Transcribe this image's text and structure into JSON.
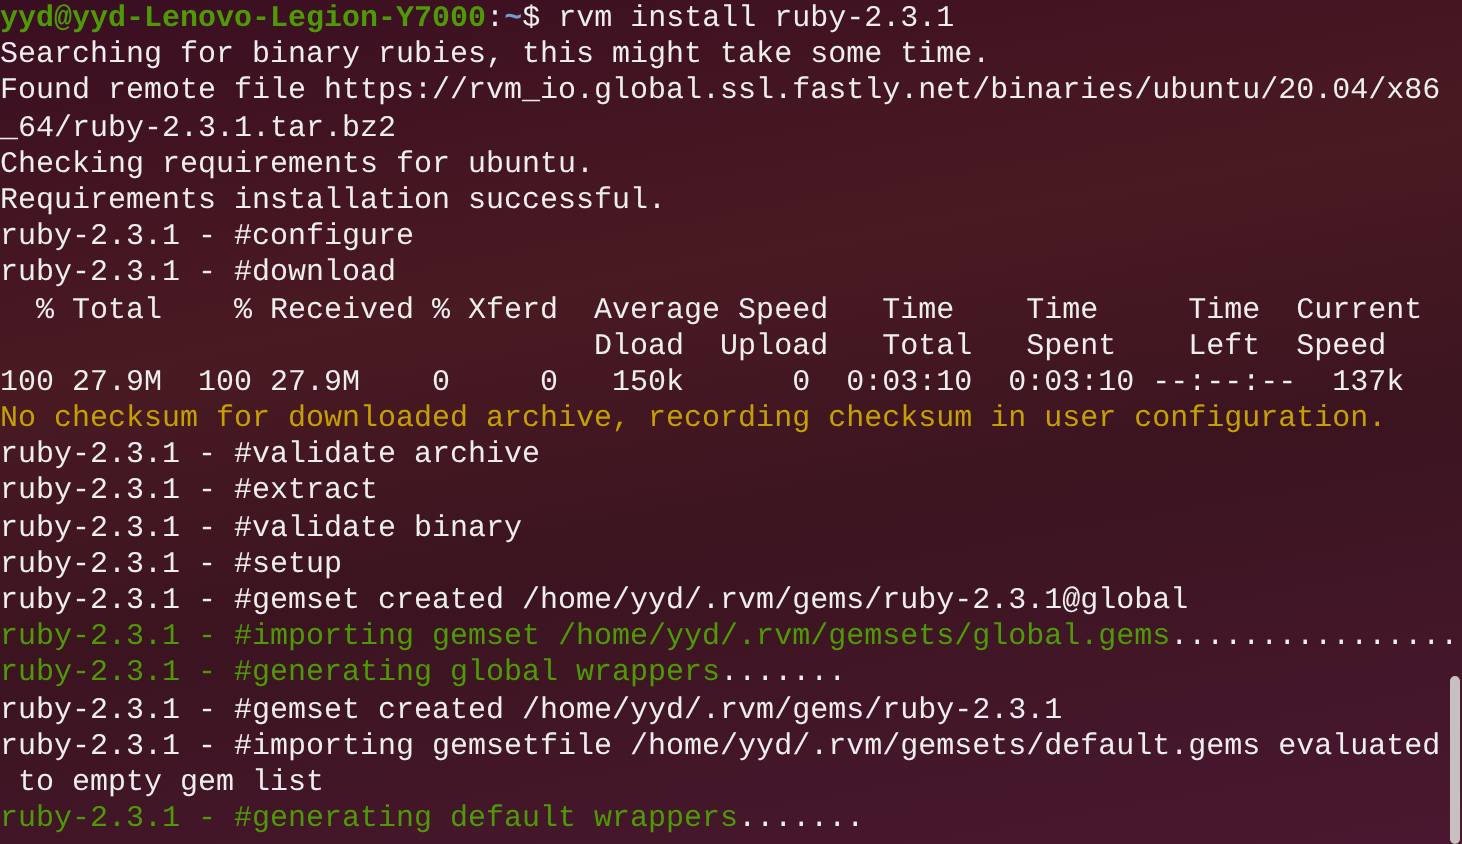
{
  "terminal": {
    "lines": [
      [
        {
          "kind": "user",
          "text": "yyd@yyd-Lenovo-Legion-Y7000"
        },
        {
          "kind": "plain",
          "text": ":"
        },
        {
          "kind": "path",
          "text": "~"
        },
        {
          "kind": "plain",
          "text": "$ rvm install ruby-2.3.1"
        }
      ],
      [
        {
          "kind": "plain",
          "text": "Searching for binary rubies, this might take some time."
        }
      ],
      [
        {
          "kind": "plain",
          "text": "Found remote file https://rvm_io.global.ssl.fastly.net/binaries/ubuntu/20.04/x86"
        }
      ],
      [
        {
          "kind": "plain",
          "text": "_64/ruby-2.3.1.tar.bz2"
        }
      ],
      [
        {
          "kind": "plain",
          "text": "Checking requirements for ubuntu."
        }
      ],
      [
        {
          "kind": "plain",
          "text": "Requirements installation successful."
        }
      ],
      [
        {
          "kind": "plain",
          "text": "ruby-2.3.1 - #configure"
        }
      ],
      [
        {
          "kind": "plain",
          "text": "ruby-2.3.1 - #download"
        }
      ],
      [
        {
          "kind": "plain",
          "text": "  % Total    % Received % Xferd  Average Speed   Time    Time     Time  Current"
        }
      ],
      [
        {
          "kind": "plain",
          "text": "                                 Dload  Upload   Total   Spent    Left  Speed"
        }
      ],
      [
        {
          "kind": "plain",
          "text": "100 27.9M  100 27.9M    0     0   150k      0  0:03:10  0:03:10 --:--:--  137k"
        }
      ],
      [
        {
          "kind": "warning",
          "text": "No checksum for downloaded archive, recording checksum in user configuration."
        }
      ],
      [
        {
          "kind": "plain",
          "text": "ruby-2.3.1 - #validate archive"
        }
      ],
      [
        {
          "kind": "plain",
          "text": "ruby-2.3.1 - #extract"
        }
      ],
      [
        {
          "kind": "plain",
          "text": "ruby-2.3.1 - #validate binary"
        }
      ],
      [
        {
          "kind": "plain",
          "text": "ruby-2.3.1 - #setup"
        }
      ],
      [
        {
          "kind": "plain",
          "text": "ruby-2.3.1 - #gemset created /home/yyd/.rvm/gems/ruby-2.3.1@global"
        }
      ],
      [
        {
          "kind": "step",
          "text": "ruby-2.3.1 - #importing gemset /home/yyd/.rvm/gemsets/global.gems"
        },
        {
          "kind": "plain",
          "text": "................"
        }
      ],
      [
        {
          "kind": "step",
          "text": "ruby-2.3.1 - #generating global wrappers"
        },
        {
          "kind": "plain",
          "text": "......."
        }
      ],
      [
        {
          "kind": "plain",
          "text": "ruby-2.3.1 - #gemset created /home/yyd/.rvm/gems/ruby-2.3.1"
        }
      ],
      [
        {
          "kind": "plain",
          "text": "ruby-2.3.1 - #importing gemsetfile /home/yyd/.rvm/gemsets/default.gems evaluated"
        }
      ],
      [
        {
          "kind": "plain",
          "text": " to empty gem list"
        }
      ],
      [
        {
          "kind": "step",
          "text": "ruby-2.3.1 - #generating default wrappers"
        },
        {
          "kind": "plain",
          "text": "......."
        }
      ]
    ]
  }
}
